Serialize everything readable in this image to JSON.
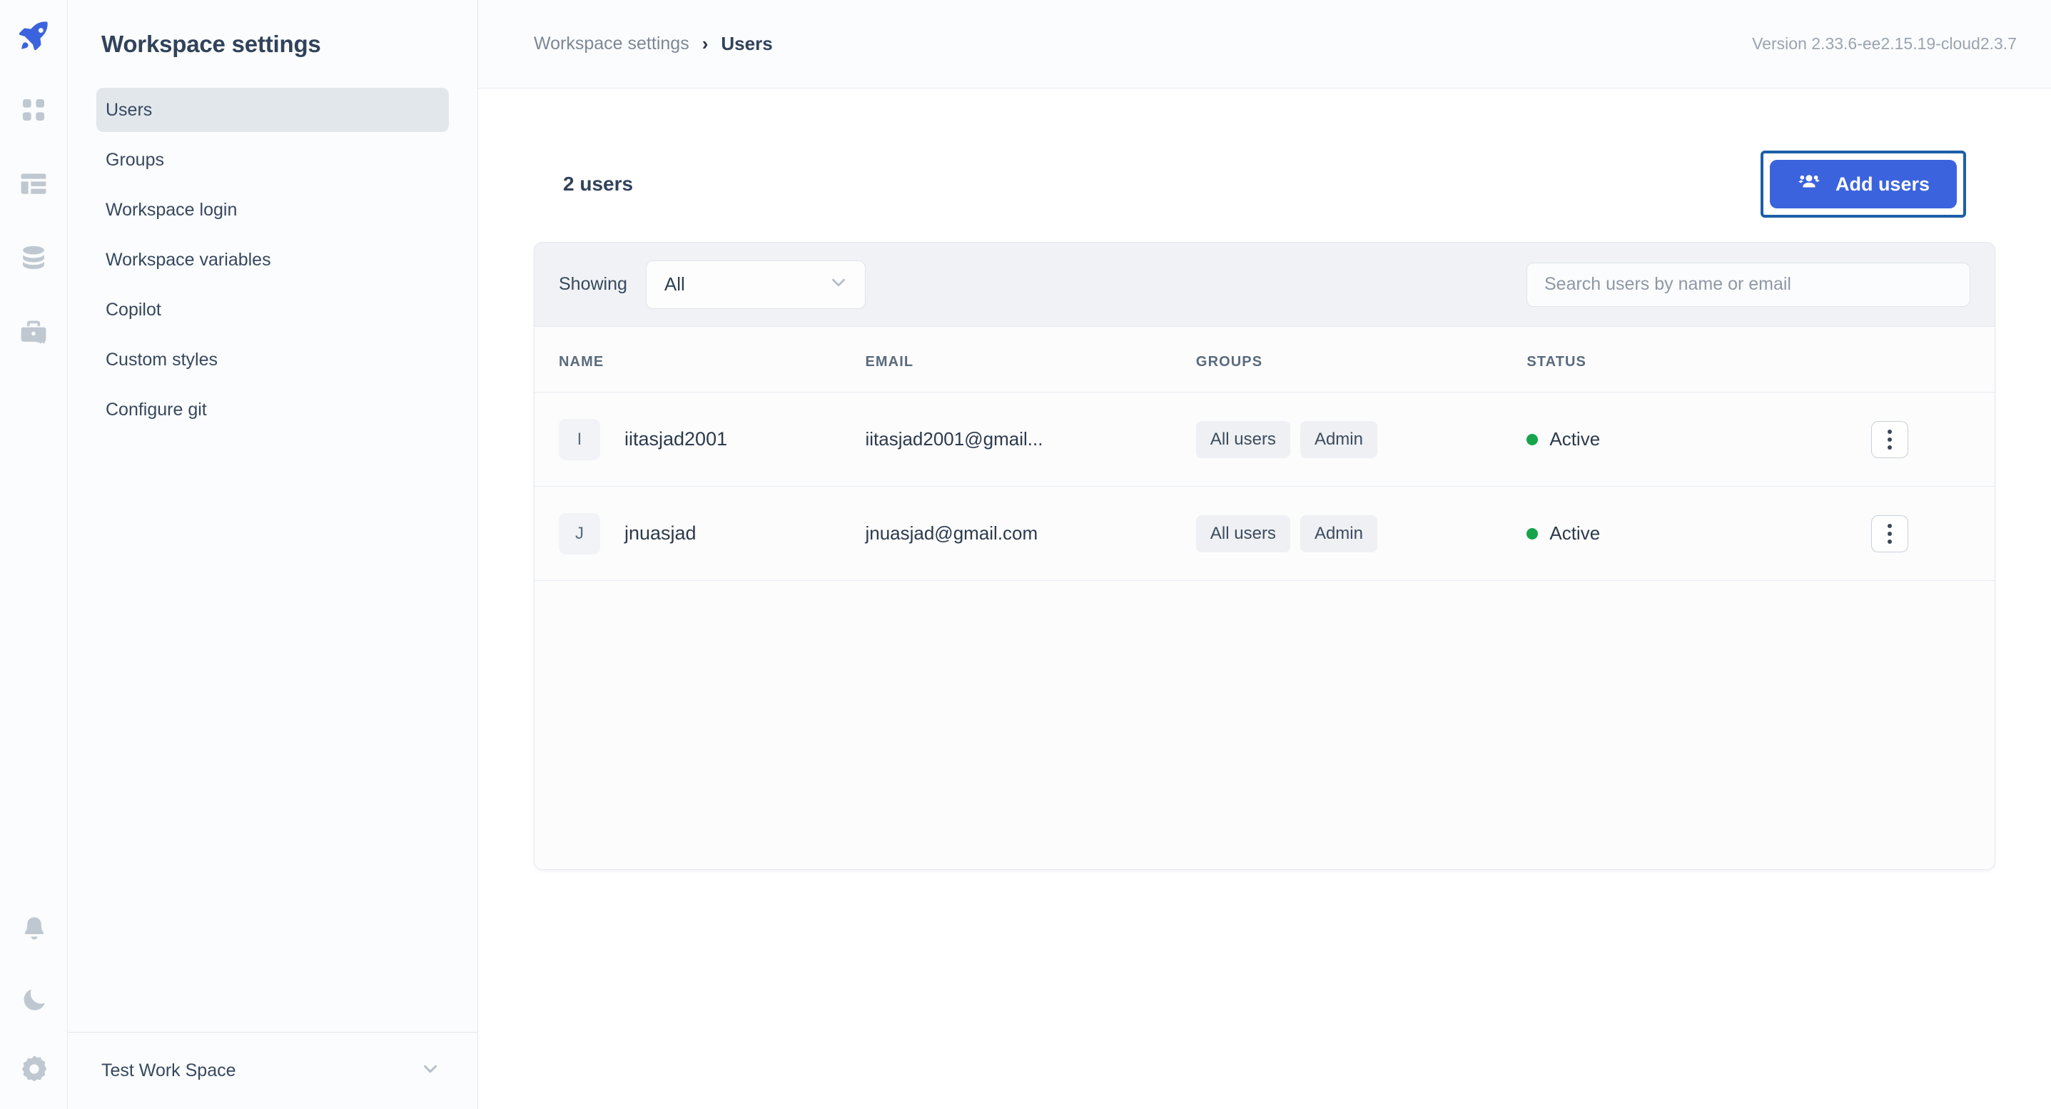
{
  "rail": {
    "logo_icon": "rocket-icon",
    "top_icons": [
      "apps-grid-icon",
      "dashboard-layout-icon",
      "database-icon",
      "toolkit-key-icon"
    ],
    "bottom_icons": [
      "bell-icon",
      "moon-icon",
      "gear-icon"
    ]
  },
  "sidebar": {
    "title": "Workspace settings",
    "items": [
      {
        "label": "Users",
        "active": true
      },
      {
        "label": "Groups",
        "active": false
      },
      {
        "label": "Workspace login",
        "active": false
      },
      {
        "label": "Workspace variables",
        "active": false
      },
      {
        "label": "Copilot",
        "active": false
      },
      {
        "label": "Custom styles",
        "active": false
      },
      {
        "label": "Configure git",
        "active": false
      }
    ],
    "workspace_switcher": {
      "name": "Test Work Space",
      "chevron_icon": "chevron-down-icon"
    }
  },
  "topbar": {
    "breadcrumb_root": "Workspace settings",
    "breadcrumb_sep": "›",
    "breadcrumb_current": "Users",
    "version": "Version 2.33.6-ee2.15.19-cloud2.3.7"
  },
  "main": {
    "users_count": "2 users",
    "add_users_button": {
      "label": "Add users",
      "icon": "users-group-icon",
      "bg": "#3b63dd",
      "focus_ring": "#1d5fa8"
    },
    "filter": {
      "showing_label": "Showing",
      "select_value": "All",
      "select_options": [
        "All"
      ],
      "select_chevron": "chevron-down-icon",
      "search_placeholder": "Search users by name or email",
      "search_value": ""
    },
    "table": {
      "columns": [
        "NAME",
        "EMAIL",
        "GROUPS",
        "STATUS"
      ],
      "rows": [
        {
          "initial": "I",
          "name": "iitasjad2001",
          "email": "iitasjad2001@gmail...",
          "groups": [
            "All users",
            "Admin"
          ],
          "status": "Active",
          "status_color": "#17a44a",
          "menu_icon": "kebab-menu-icon"
        },
        {
          "initial": "J",
          "name": "jnuasjad",
          "email": "jnuasjad@gmail.com",
          "groups": [
            "All users",
            "Admin"
          ],
          "status": "Active",
          "status_color": "#17a44a",
          "menu_icon": "kebab-menu-icon"
        }
      ]
    }
  }
}
